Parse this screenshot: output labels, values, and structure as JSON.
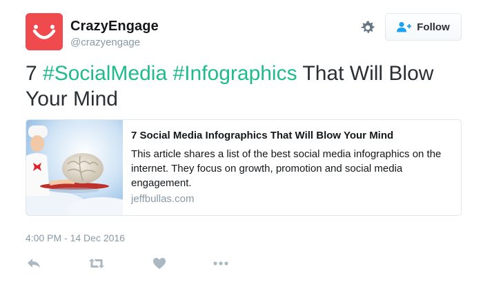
{
  "user": {
    "display_name": "CrazyEngage",
    "handle": "@crazyengage",
    "avatar_icon": "smile-logo-icon",
    "avatar_color": "#ef4a4e"
  },
  "header": {
    "settings_icon": "gear-icon",
    "follow_label": "Follow",
    "follow_icon": "add-user-icon"
  },
  "tweet": {
    "text_prefix": "7 ",
    "hashtag_1": "#SocialMedia",
    "hashtag_2": "#Infographics",
    "text_suffix": " That Will Blow Your Mind",
    "hashtag_color": "#1fbb8a"
  },
  "card": {
    "title": "7 Social Media Infographics That Will Blow Your Mind",
    "description": "This article shares a list of the best social media infographics on the internet. They focus on growth, promotion and social media engagement.",
    "domain": "jeffbullas.com"
  },
  "footer": {
    "timestamp": "4:00 PM - 14 Dec 2016",
    "actions": [
      "reply-icon",
      "retweet-icon",
      "like-icon",
      "more-icon"
    ]
  }
}
